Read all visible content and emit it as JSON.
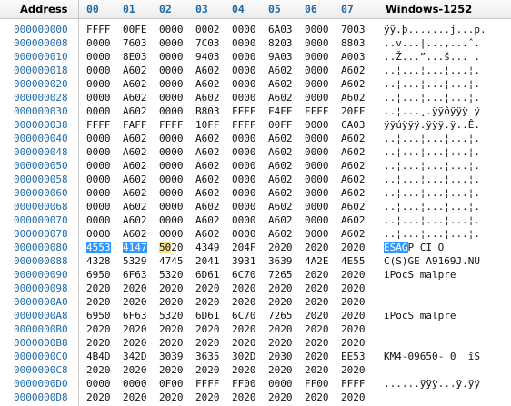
{
  "header": {
    "address_label": "Address",
    "columns": [
      "00",
      "01",
      "02",
      "03",
      "04",
      "05",
      "06",
      "07"
    ],
    "encoding": "Windows-1252"
  },
  "rows": [
    {
      "addr": "000000000",
      "words": [
        "FFFF",
        "00FE",
        "0000",
        "0002",
        "0000",
        "6A03",
        "0000",
        "7003"
      ],
      "text": "ÿÿ.þ.......j...p."
    },
    {
      "addr": "000000008",
      "words": [
        "0000",
        "7603",
        "0000",
        "7C03",
        "0000",
        "8203",
        "0000",
        "8803"
      ],
      "text": "..v...|...‚...ˆ."
    },
    {
      "addr": "000000010",
      "words": [
        "0000",
        "8E03",
        "0000",
        "9403",
        "0000",
        "9A03",
        "0000",
        "A003"
      ],
      "text": "..Ž...”...š... ."
    },
    {
      "addr": "000000018",
      "words": [
        "0000",
        "A602",
        "0000",
        "A602",
        "0000",
        "A602",
        "0000",
        "A602"
      ],
      "text": "..¦...¦...¦...¦."
    },
    {
      "addr": "000000020",
      "words": [
        "0000",
        "A602",
        "0000",
        "A602",
        "0000",
        "A602",
        "0000",
        "A602"
      ],
      "text": "..¦...¦...¦...¦."
    },
    {
      "addr": "000000028",
      "words": [
        "0000",
        "A602",
        "0000",
        "A602",
        "0000",
        "A602",
        "0000",
        "A602"
      ],
      "text": "..¦...¦...¦...¦."
    },
    {
      "addr": "000000030",
      "words": [
        "0000",
        "A602",
        "0000",
        "B803",
        "FFFF",
        "F4FF",
        "FFFF",
        "20FF"
      ],
      "text": "..¦...¸.ÿÿôÿÿÿ ÿ"
    },
    {
      "addr": "000000038",
      "words": [
        "FFFF",
        "FAFF",
        "FFFF",
        "10FF",
        "FFFF",
        "00FF",
        "0000",
        "CA03"
      ],
      "text": "ÿÿúÿÿÿ.ÿÿÿ.ÿ..Ê."
    },
    {
      "addr": "000000040",
      "words": [
        "0000",
        "A602",
        "0000",
        "A602",
        "0000",
        "A602",
        "0000",
        "A602"
      ],
      "text": "..¦...¦...¦...¦."
    },
    {
      "addr": "000000048",
      "words": [
        "0000",
        "A602",
        "0000",
        "A602",
        "0000",
        "A602",
        "0000",
        "A602"
      ],
      "text": "..¦...¦...¦...¦."
    },
    {
      "addr": "000000050",
      "words": [
        "0000",
        "A602",
        "0000",
        "A602",
        "0000",
        "A602",
        "0000",
        "A602"
      ],
      "text": "..¦...¦...¦...¦."
    },
    {
      "addr": "000000058",
      "words": [
        "0000",
        "A602",
        "0000",
        "A602",
        "0000",
        "A602",
        "0000",
        "A602"
      ],
      "text": "..¦...¦...¦...¦."
    },
    {
      "addr": "000000060",
      "words": [
        "0000",
        "A602",
        "0000",
        "A602",
        "0000",
        "A602",
        "0000",
        "A602"
      ],
      "text": "..¦...¦...¦...¦."
    },
    {
      "addr": "000000068",
      "words": [
        "0000",
        "A602",
        "0000",
        "A602",
        "0000",
        "A602",
        "0000",
        "A602"
      ],
      "text": "..¦...¦...¦...¦."
    },
    {
      "addr": "000000070",
      "words": [
        "0000",
        "A602",
        "0000",
        "A602",
        "0000",
        "A602",
        "0000",
        "A602"
      ],
      "text": "..¦...¦...¦...¦."
    },
    {
      "addr": "000000078",
      "words": [
        "0000",
        "A602",
        "0000",
        "A602",
        "0000",
        "A602",
        "0000",
        "A602"
      ],
      "text": "..¦...¦...¦...¦."
    },
    {
      "addr": "000000080",
      "words": [
        "4553",
        "4147",
        "5020",
        "4349",
        "204F",
        "2020",
        "2020",
        "2020"
      ],
      "text": "ESAGP CI O      "
    },
    {
      "addr": "000000088",
      "words": [
        "4328",
        "5329",
        "4745",
        "2041",
        "3931",
        "3639",
        "4A2E",
        "4E55"
      ],
      "text": "C(S)GE A9169J.NU"
    },
    {
      "addr": "000000090",
      "words": [
        "6950",
        "6F63",
        "5320",
        "6D61",
        "6C70",
        "7265",
        "2020",
        "2020"
      ],
      "text": "iPocS malpre    "
    },
    {
      "addr": "000000098",
      "words": [
        "2020",
        "2020",
        "2020",
        "2020",
        "2020",
        "2020",
        "2020",
        "2020"
      ],
      "text": "                "
    },
    {
      "addr": "0000000A0",
      "words": [
        "2020",
        "2020",
        "2020",
        "2020",
        "2020",
        "2020",
        "2020",
        "2020"
      ],
      "text": "                "
    },
    {
      "addr": "0000000A8",
      "words": [
        "6950",
        "6F63",
        "5320",
        "6D61",
        "6C70",
        "7265",
        "2020",
        "2020"
      ],
      "text": "iPocS malpre    "
    },
    {
      "addr": "0000000B0",
      "words": [
        "2020",
        "2020",
        "2020",
        "2020",
        "2020",
        "2020",
        "2020",
        "2020"
      ],
      "text": "                "
    },
    {
      "addr": "0000000B8",
      "words": [
        "2020",
        "2020",
        "2020",
        "2020",
        "2020",
        "2020",
        "2020",
        "2020"
      ],
      "text": "                "
    },
    {
      "addr": "0000000C0",
      "words": [
        "4B4D",
        "342D",
        "3039",
        "3635",
        "302D",
        "2030",
        "2020",
        "EE53"
      ],
      "text": "KM4-09650- 0  îS"
    },
    {
      "addr": "0000000C8",
      "words": [
        "2020",
        "2020",
        "2020",
        "2020",
        "2020",
        "2020",
        "2020",
        "2020"
      ],
      "text": "                "
    },
    {
      "addr": "0000000D0",
      "words": [
        "0000",
        "0000",
        "0F00",
        "FFFF",
        "FF00",
        "0000",
        "FF00",
        "FFFF"
      ],
      "text": "......ÿÿÿ...ÿ.ÿÿ"
    },
    {
      "addr": "0000000D8",
      "words": [
        "2020",
        "2020",
        "2020",
        "2020",
        "2020",
        "2020",
        "2020",
        "2020"
      ],
      "text": "                "
    }
  ],
  "selection": {
    "row_addr": "000000080",
    "selected_hex": [
      "4553",
      "4147"
    ],
    "cursor_byte": "50",
    "selected_text": "ESAG"
  }
}
